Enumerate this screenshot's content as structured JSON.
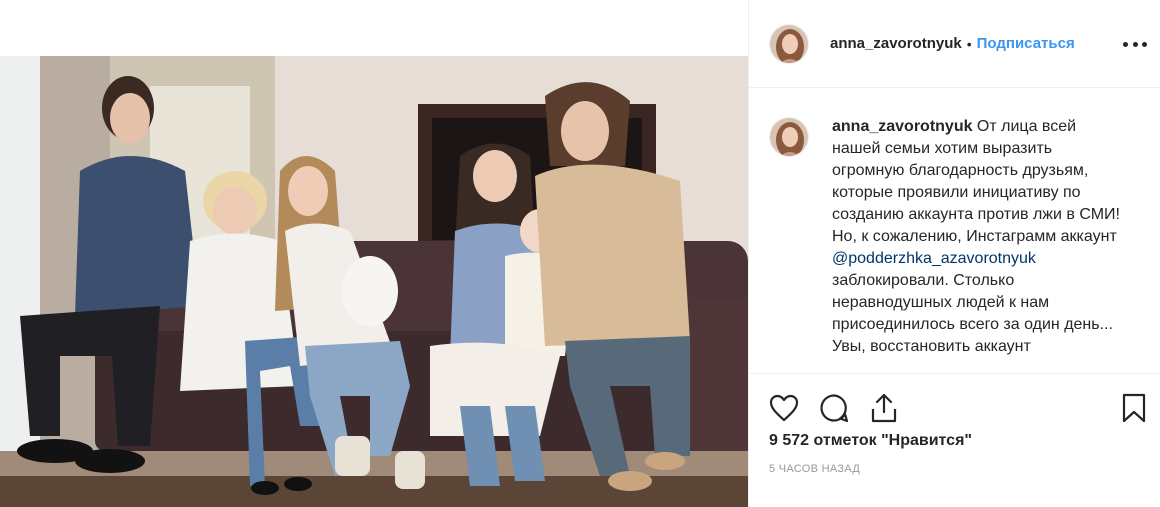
{
  "post": {
    "username": "anna_zavorotnyuk",
    "separator": "•",
    "follow_label": "Подписаться",
    "more_icon": "more-horizontal-icon",
    "photo_alt": "Семейное фото"
  },
  "caption": {
    "username": "anna_zavorotnyuk",
    "text_before_mention": " От лица всей нашей семьи хотим выразить огромную благодарность друзьям, которые проявили инициативу по созданию аккаунта против лжи в СМИ! Но, к сожалению, Инстаграмм аккаунт ",
    "mention": "@podderzhka_azavorotnyuk",
    "text_after_mention": " заблокировали. Столько неравнодушных людей к нам присоединилось всего за один день... Увы, восстановить аккаунт"
  },
  "actions": {
    "like_icon": "heart-icon",
    "comment_icon": "comment-icon",
    "share_icon": "share-icon",
    "save_icon": "bookmark-icon"
  },
  "stats": {
    "likes": "9 572 отметок \"Нравится\"",
    "time": "5 ЧАСОВ НАЗАД"
  },
  "colors": {
    "link": "#3897f0",
    "mention": "#003569",
    "border": "#efefef"
  }
}
